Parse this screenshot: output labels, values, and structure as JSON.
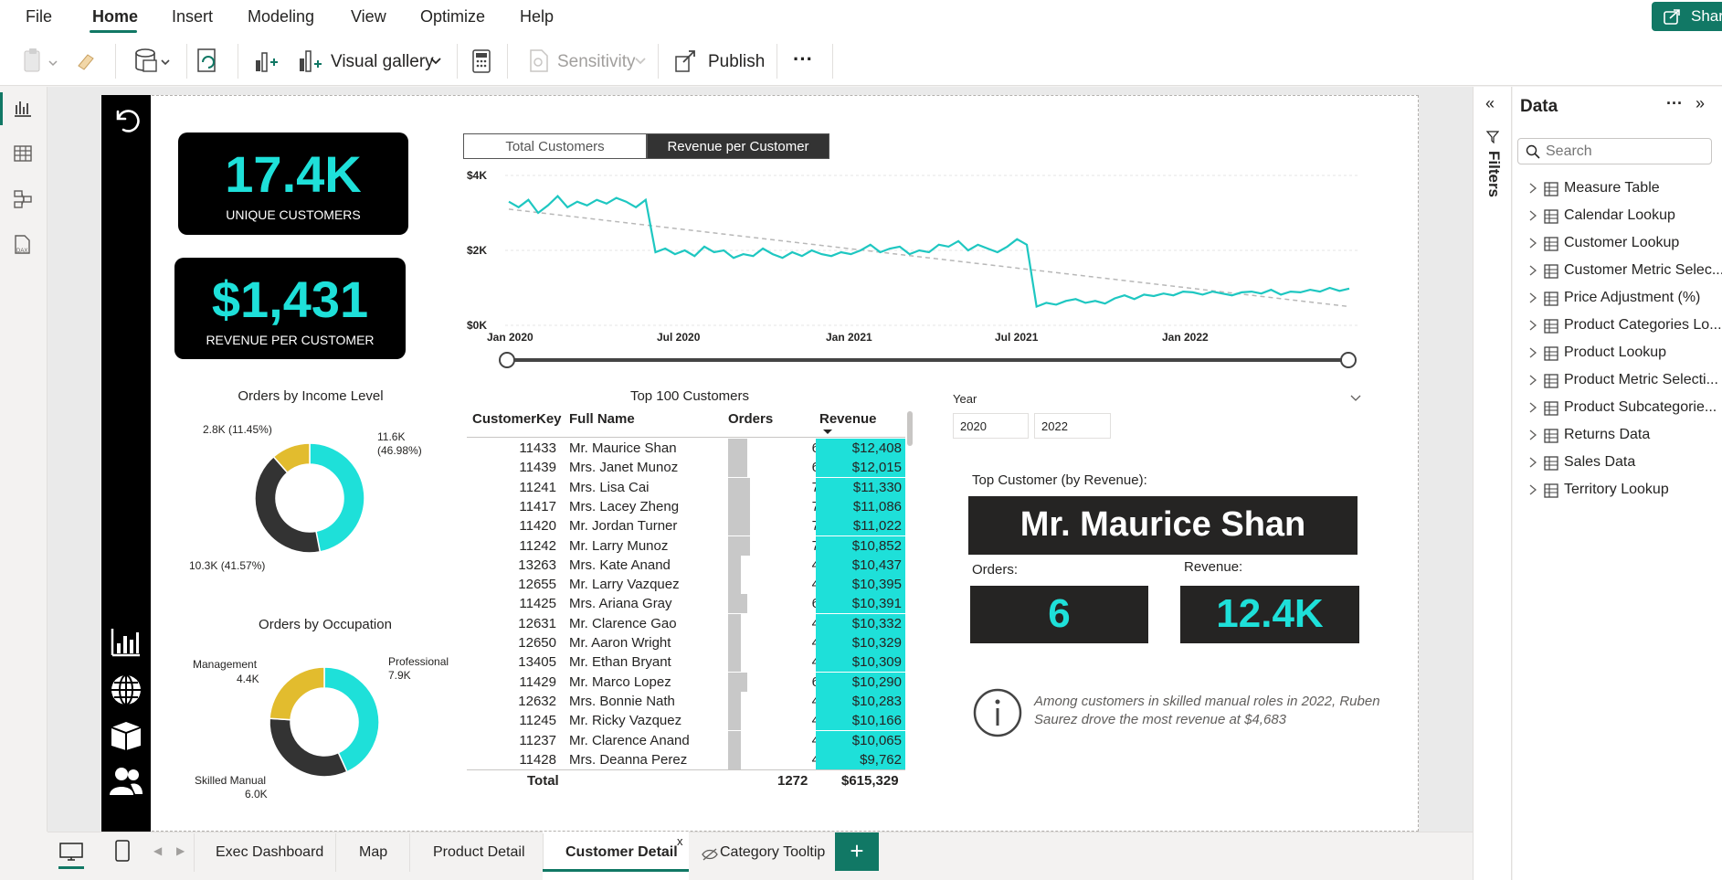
{
  "menu": {
    "items": [
      "File",
      "Home",
      "Insert",
      "Modeling",
      "View",
      "Optimize",
      "Help"
    ],
    "active": "Home",
    "share": "Share"
  },
  "toolbar": {
    "visual_gallery": "Visual gallery",
    "sensitivity": "Sensitivity",
    "publish": "Publish",
    "more": "···"
  },
  "kpis": {
    "customers": {
      "value": "17.4K",
      "label": "UNIQUE CUSTOMERS"
    },
    "revenue": {
      "value": "$1,431",
      "label": "REVENUE PER CUSTOMER"
    }
  },
  "line_chart": {
    "buttons": [
      "Total Customers",
      "Revenue per Customer"
    ],
    "active_button": "Revenue per Customer",
    "y_ticks": [
      "$4K",
      "$2K",
      "$0K"
    ],
    "x_ticks": [
      "Jan 2020",
      "Jul 2020",
      "Jan 2021",
      "Jul 2021",
      "Jan 2022"
    ]
  },
  "chart_data": [
    {
      "type": "line",
      "series": [
        {
          "values": [
            3300,
            3150,
            3350,
            3000,
            3200,
            3450,
            3150,
            3300,
            3200,
            3350,
            3250,
            3400,
            3300,
            3150,
            3350,
            1950,
            2050,
            1900,
            2000,
            1850,
            2100,
            1950,
            2000,
            1800,
            1900,
            1850,
            2050,
            1900,
            1800,
            1950,
            1850,
            2000,
            1900,
            1850,
            1950,
            1900,
            2000,
            2150,
            1950,
            2050,
            2100,
            1900,
            2000,
            1950,
            2150,
            2100,
            2250,
            2000,
            2150,
            2050,
            1950,
            2100,
            2300,
            2150,
            500,
            600,
            550,
            650,
            700,
            600,
            650,
            580,
            720,
            800,
            700,
            820,
            780,
            850,
            800,
            900,
            880,
            820,
            900,
            850,
            800,
            880,
            900,
            850,
            950,
            820,
            900,
            880,
            950,
            900,
            1000,
            920,
            980
          ]
        }
      ],
      "trendline": {
        "start": 3100,
        "end": 500
      },
      "y_range": [
        0,
        4000
      ],
      "x_range": [
        "Jan 2020",
        "Jun 2022"
      ]
    },
    {
      "type": "pie",
      "title": "Orders by Income Level",
      "slices": [
        {
          "label": "11.6K (46.98%)",
          "value": 46.98,
          "color": "#1ee0d9"
        },
        {
          "label": "10.3K (41.57%)",
          "value": 41.57,
          "color": "#333333"
        },
        {
          "label": "2.8K (11.45%)",
          "value": 11.45,
          "color": "#e2bc2e"
        }
      ]
    },
    {
      "type": "pie",
      "title": "Orders by Occupation",
      "slices": [
        {
          "label": "Professional 7.9K",
          "value": 43.2,
          "color": "#1ee0d9"
        },
        {
          "label": "Skilled Manual 6.0K",
          "value": 32.8,
          "color": "#333333"
        },
        {
          "label": "Management 4.4K",
          "value": 24.0,
          "color": "#e2bc2e"
        }
      ]
    }
  ],
  "donut_labels": {
    "income": {
      "a": "11.6K",
      "a2": "(46.98%)",
      "b": "10.3K (41.57%)",
      "c": "2.8K (11.45%)"
    },
    "occupation": {
      "a": "Professional",
      "a2": "7.9K",
      "b": "Skilled Manual",
      "b2": "6.0K",
      "c": "Management",
      "c2": "4.4K"
    }
  },
  "table": {
    "title": "Top 100 Customers",
    "headers": [
      "CustomerKey",
      "Full Name",
      "Orders",
      "Revenue"
    ],
    "rows": [
      {
        "key": "11433",
        "name": "Mr. Maurice Shan",
        "orders": 6,
        "revenue": "$12,408"
      },
      {
        "key": "11439",
        "name": "Mrs. Janet Munoz",
        "orders": 6,
        "revenue": "$12,015"
      },
      {
        "key": "11241",
        "name": "Mrs. Lisa Cai",
        "orders": 7,
        "revenue": "$11,330"
      },
      {
        "key": "11417",
        "name": "Mrs. Lacey Zheng",
        "orders": 7,
        "revenue": "$11,086"
      },
      {
        "key": "11420",
        "name": "Mr. Jordan Turner",
        "orders": 7,
        "revenue": "$11,022"
      },
      {
        "key": "11242",
        "name": "Mr. Larry Munoz",
        "orders": 7,
        "revenue": "$10,852"
      },
      {
        "key": "13263",
        "name": "Mrs. Kate Anand",
        "orders": 4,
        "revenue": "$10,437"
      },
      {
        "key": "12655",
        "name": "Mr. Larry Vazquez",
        "orders": 4,
        "revenue": "$10,395"
      },
      {
        "key": "11425",
        "name": "Mrs. Ariana Gray",
        "orders": 6,
        "revenue": "$10,391"
      },
      {
        "key": "12631",
        "name": "Mr. Clarence Gao",
        "orders": 4,
        "revenue": "$10,332"
      },
      {
        "key": "12650",
        "name": "Mr. Aaron Wright",
        "orders": 4,
        "revenue": "$10,329"
      },
      {
        "key": "13405",
        "name": "Mr. Ethan Bryant",
        "orders": 4,
        "revenue": "$10,309"
      },
      {
        "key": "11429",
        "name": "Mr. Marco Lopez",
        "orders": 6,
        "revenue": "$10,290"
      },
      {
        "key": "12632",
        "name": "Mrs. Bonnie Nath",
        "orders": 4,
        "revenue": "$10,283"
      },
      {
        "key": "11245",
        "name": "Mr. Ricky Vazquez",
        "orders": 4,
        "revenue": "$10,166"
      },
      {
        "key": "11237",
        "name": "Mr. Clarence Anand",
        "orders": 4,
        "revenue": "$10,065"
      },
      {
        "key": "11428",
        "name": "Mrs. Deanna Perez",
        "orders": 4,
        "revenue": "$9,762"
      }
    ],
    "total": {
      "label": "Total",
      "orders": "1272",
      "revenue": "$615,329"
    }
  },
  "year_slicer": {
    "label": "Year",
    "from": "2020",
    "to": "2022"
  },
  "top_customer": {
    "label": "Top Customer (by Revenue):",
    "name": "Mr. Maurice Shan",
    "orders_label": "Orders:",
    "orders": "6",
    "revenue_label": "Revenue:",
    "revenue": "12.4K",
    "insight": "Among customers in skilled manual roles in 2022, Ruben Saurez drove the most revenue at $4,683"
  },
  "tabs": {
    "items": [
      "Exec Dashboard",
      "Map",
      "Product Detail",
      "Customer Detail",
      "Category Tooltip"
    ],
    "active": "Customer Detail",
    "close": "x"
  },
  "filters_label": "Filters",
  "data_panel": {
    "title": "Data",
    "search_placeholder": "Search",
    "items": [
      "Measure Table",
      "Calendar Lookup",
      "Customer Lookup",
      "Customer Metric Selec...",
      "Price Adjustment (%)",
      "Product Categories Lo...",
      "Product Lookup",
      "Product Metric Selecti...",
      "Product Subcategorie...",
      "Returns Data",
      "Sales Data",
      "Territory Lookup"
    ]
  },
  "colors": {
    "accent": "#117865",
    "teal": "#1ee0d9",
    "gold": "#e2bc2e",
    "dark": "#333333"
  }
}
